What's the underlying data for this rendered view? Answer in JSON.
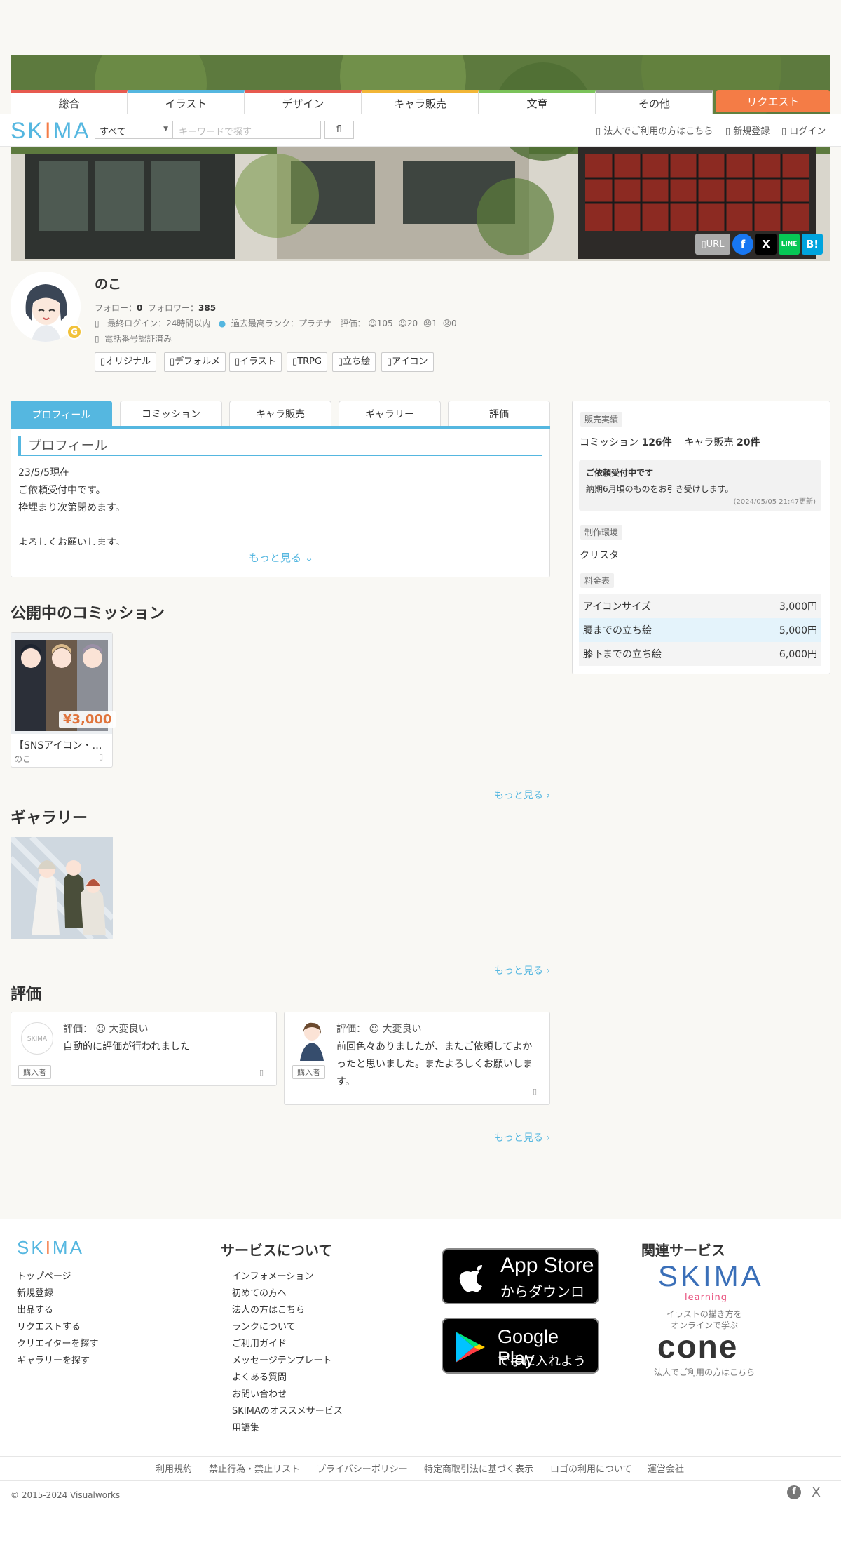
{
  "nav": {
    "tabs": [
      {
        "label": "総合",
        "color": "#e75a4f"
      },
      {
        "label": "イラスト",
        "color": "#55b7e0"
      },
      {
        "label": "デザイン",
        "color": "#e75a4f"
      },
      {
        "label": "キャラ販売",
        "color": "#f2b636"
      },
      {
        "label": "文章",
        "color": "#7bc35a"
      },
      {
        "label": "その他",
        "color": "#999999"
      }
    ],
    "request_label": "リクエスト"
  },
  "header": {
    "logo": "SKIMA",
    "category_select": "すべて",
    "search_placeholder": "キーワードで探す",
    "search_button": "fl",
    "links": [
      "法人でご利用の方はこちら",
      "新規登録",
      "ログイン"
    ]
  },
  "share": {
    "url_label": "URL",
    "facebook": "f",
    "x": "X",
    "line": "LINE",
    "hatena": "B!"
  },
  "profile": {
    "name": "のこ",
    "follow_label": "フォロー：",
    "follow_count": "0",
    "follower_label": "フォロワー：",
    "follower_count": "385",
    "last_login": "最終ログイン：24時間以内",
    "best_rank": "過去最高ランク：プラチナ",
    "rating_label": "評価：",
    "ratings": [
      "105",
      "20",
      "1",
      "0"
    ],
    "phone_verified": "電話番号認証済み",
    "tags": [
      "オリジナル",
      "デフォルメ",
      "イラスト",
      "TRPG",
      "立ち絵",
      "アイコン"
    ]
  },
  "profile_tabs": [
    "プロフィール",
    "コミッション",
    "キャラ販売",
    "ギャラリー",
    "評価"
  ],
  "about": {
    "heading": "プロフィール",
    "lines": [
      "23/5/5現在",
      "ご依頼受付中です。",
      "枠埋まり次第閉めます。",
      "",
      "よろしくお願いします。"
    ],
    "more": "もっと見る"
  },
  "sidebar": {
    "sales_label": "販売実績",
    "commission_label": "コミッション",
    "commission_count": "126件",
    "chara_label": "キャラ販売",
    "chara_count": "20件",
    "status_title": "ご依頼受付中です",
    "status_body": "納期6月頃のものをお引き受けします。",
    "status_updated": "(2024/05/05 21:47更新)",
    "env_label": "制作環境",
    "env_value": "クリスタ",
    "price_label": "料金表",
    "prices": [
      {
        "name": "アイコンサイズ",
        "price": "3,000円"
      },
      {
        "name": "腰までの立ち絵",
        "price": "5,000円"
      },
      {
        "name": "膝下までの立ち絵",
        "price": "6,000円"
      }
    ]
  },
  "commissions": {
    "title": "公開中のコミッション",
    "item_title": "【SNSアイコン・…",
    "item_author": "のこ",
    "item_price": "¥3,000",
    "more": "もっと見る ›"
  },
  "gallery": {
    "title": "ギャラリー",
    "more": "もっと見る ›"
  },
  "reviews": {
    "title": "評価",
    "items": [
      {
        "label": "評価：",
        "grade": "大変良い",
        "text": "自動的に評価が行われました",
        "badge": "購入者"
      },
      {
        "label": "評価：",
        "grade": "大変良い",
        "text": "前回色々ありましたが、またご依頼してよかったと思いました。またよろしくお願いします。",
        "badge": "購入者"
      }
    ],
    "more": "もっと見る ›"
  },
  "footer": {
    "logo": "SKIMA",
    "links": [
      "トップページ",
      "新規登録",
      "出品する",
      "リクエストする",
      "クリエイターを探す",
      "ギャラリーを探す"
    ],
    "service_title": "サービスについて",
    "service_links": [
      "インフォメーション",
      "初めての方へ",
      "法人の方はこちら",
      "ランクについて",
      "ご利用ガイド",
      "メッセージテンプレート",
      "よくある質問",
      "お問い合わせ",
      "SKIMAのオススメサービス",
      "用語集"
    ],
    "appstore_line1": "App Store",
    "appstore_line2": "からダウンロード",
    "googleplay_line1": "Google Play",
    "googleplay_line2": "で手に入れよう",
    "related_title": "関連サービス",
    "learning_logo": "SKIMA",
    "learning_sub": "learning",
    "learning_caption1": "イラストの描き方を",
    "learning_caption2": "オンラインで学ぶ",
    "cone_logo": "cone",
    "cone_caption": "法人でご利用の方はこちら",
    "bottom_links": [
      "利用規約",
      "禁止行為・禁止リスト",
      "プライバシーポリシー",
      "特定商取引法に基づく表示",
      "ロゴの利用について",
      "運営会社"
    ],
    "copyright": "© 2015-2024 Visualworks"
  },
  "colors": {
    "accent": "#55b7e0",
    "request": "#f47c46",
    "price": "#e0743c"
  }
}
